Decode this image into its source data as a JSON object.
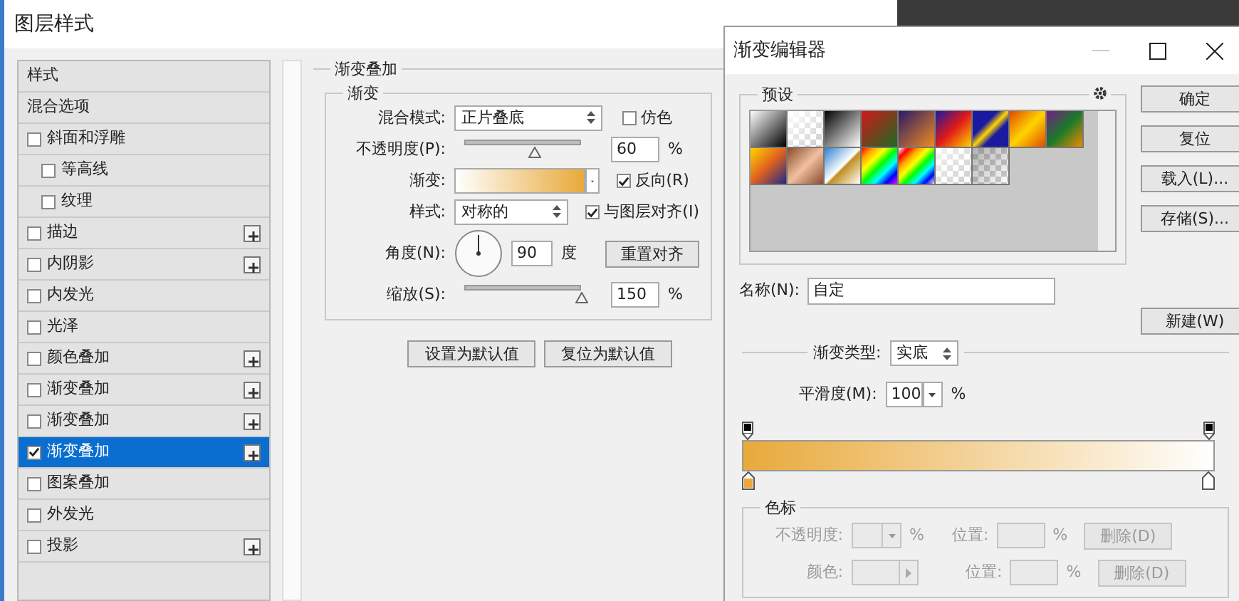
{
  "dialog": {
    "title": "图层样式",
    "style_list": [
      {
        "label": "样式",
        "kind": "header",
        "selected": false
      },
      {
        "label": "混合选项",
        "kind": "header",
        "selected": false
      },
      {
        "label": "斜面和浮雕",
        "kind": "check",
        "checked": false,
        "selected": false,
        "children": [
          {
            "label": "等高线",
            "kind": "check",
            "checked": false,
            "selected": false
          },
          {
            "label": "纹理",
            "kind": "check",
            "checked": false,
            "selected": false
          }
        ]
      },
      {
        "label": "描边",
        "kind": "check",
        "checked": false,
        "selected": false,
        "addable": true
      },
      {
        "label": "内阴影",
        "kind": "check",
        "checked": false,
        "selected": false,
        "addable": true
      },
      {
        "label": "内发光",
        "kind": "check",
        "checked": false,
        "selected": false
      },
      {
        "label": "光泽",
        "kind": "check",
        "checked": false,
        "selected": false
      },
      {
        "label": "颜色叠加",
        "kind": "check",
        "checked": false,
        "selected": false,
        "addable": true
      },
      {
        "label": "渐变叠加",
        "kind": "check",
        "checked": false,
        "selected": false,
        "addable": true
      },
      {
        "label": "渐变叠加",
        "kind": "check",
        "checked": false,
        "selected": false,
        "addable": true
      },
      {
        "label": "渐变叠加",
        "kind": "check",
        "checked": true,
        "selected": true,
        "addable": true
      },
      {
        "label": "图案叠加",
        "kind": "check",
        "checked": false,
        "selected": false
      },
      {
        "label": "外发光",
        "kind": "check",
        "checked": false,
        "selected": false
      },
      {
        "label": "投影",
        "kind": "check",
        "checked": false,
        "selected": false,
        "addable": true
      }
    ],
    "panel": {
      "title": "渐变叠加",
      "group": "渐变",
      "blend_mode_label": "混合模式:",
      "blend_mode": "正片叠底",
      "dither": {
        "label": "仿色",
        "checked": false
      },
      "opacity_label": "不透明度(P):",
      "opacity_slider": {
        "level": 0.6
      },
      "opacity": "60",
      "opacity_unit": "%",
      "gradient_label": "渐变:",
      "reverse": {
        "label": "反向(R)",
        "checked": true
      },
      "style_label": "样式:",
      "style": "对称的",
      "align": {
        "label": "与图层对齐(I)",
        "checked": true
      },
      "angle_label": "角度(N):",
      "angle": "90",
      "angle_unit": "度",
      "reset_align": "重置对齐",
      "scale_label": "缩放(S):",
      "scale_slider": {
        "level": 1
      },
      "scale": "150",
      "scale_unit": "%"
    },
    "buttons": [
      "设置为默认值",
      "复位为默认值"
    ]
  },
  "editor": {
    "title": "渐变编辑器",
    "presets_label": "预设",
    "buttons": [
      "确定",
      "复位",
      "载入(L)...",
      "存储(S)..."
    ],
    "name_label": "名称(N):",
    "name": "自定",
    "new_button": "新建(W)",
    "type_label": "渐变类型:",
    "type": "实底",
    "smooth_label": "平滑度(M):",
    "smooth": "100",
    "smooth_unit": "%",
    "opacity_stops": [
      {
        "color": "#000000"
      },
      {
        "color": "#000000"
      }
    ],
    "color_stops": [
      {
        "color": "#e8a93a",
        "selected": false
      },
      {
        "color": "#ffffff",
        "selected": false
      }
    ],
    "stops_group": {
      "title": "色标",
      "disabled": true,
      "opacity_label": "不透明度:",
      "opacity_unit": "%",
      "position_label": "位置:",
      "position_unit": "%",
      "delete": "删除(D)",
      "color_label": "颜色:",
      "position2_label": "位置:",
      "position2_unit": "%",
      "delete2": "删除(D)"
    }
  }
}
